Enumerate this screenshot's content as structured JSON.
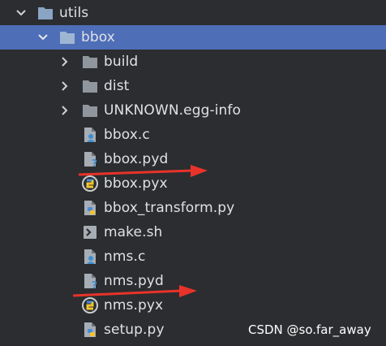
{
  "tree": {
    "items": [
      {
        "label": "utils",
        "kind": "folder",
        "expanded": true
      },
      {
        "label": "bbox",
        "kind": "folder",
        "expanded": true,
        "selected": true
      },
      {
        "label": "build",
        "kind": "folder",
        "expanded": false
      },
      {
        "label": "dist",
        "kind": "folder",
        "expanded": false
      },
      {
        "label": "UNKNOWN.egg-info",
        "kind": "folder",
        "expanded": false
      },
      {
        "label": "bbox.c",
        "kind": "c-file"
      },
      {
        "label": "bbox.pyd",
        "kind": "unknown-file"
      },
      {
        "label": "bbox.pyx",
        "kind": "cython-file"
      },
      {
        "label": "bbox_transform.py",
        "kind": "python-file"
      },
      {
        "label": "make.sh",
        "kind": "shell-file"
      },
      {
        "label": "nms.c",
        "kind": "c-file"
      },
      {
        "label": "nms.pyd",
        "kind": "unknown-file"
      },
      {
        "label": "nms.pyx",
        "kind": "cython-file"
      },
      {
        "label": "setup.py",
        "kind": "python-file"
      }
    ]
  },
  "annotations": {
    "arrow_color": "#e8332a",
    "arrow_targets": [
      "bbox.pyd",
      "nms.pyd"
    ]
  },
  "watermark": "CSDN @so.far_away",
  "colors": {
    "background": "#2b2d30",
    "selection": "#4e6eb8",
    "folder": "#8aa5c4",
    "text": "#dfe1e5"
  }
}
